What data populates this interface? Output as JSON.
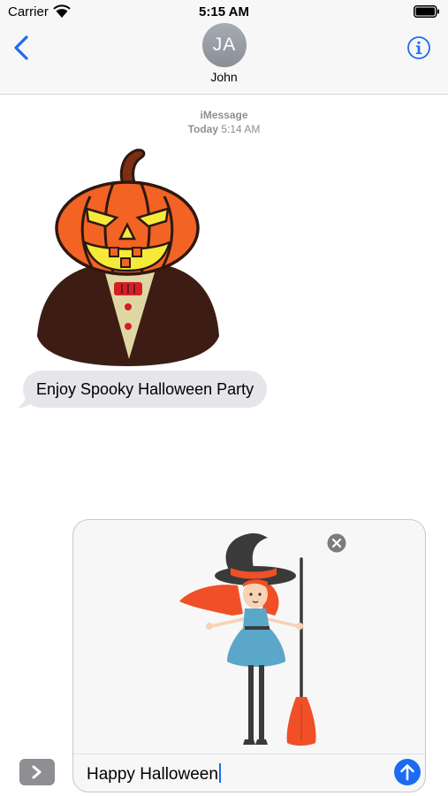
{
  "status_bar": {
    "carrier": "Carrier",
    "time": "5:15 AM"
  },
  "header": {
    "avatar_initials": "JA",
    "contact_name": "John",
    "back_icon": "chevron-left-icon",
    "info_icon": "info-icon"
  },
  "thread": {
    "service": "iMessage",
    "day": "Today",
    "time": "5:14 AM",
    "messages": [
      {
        "type": "sticker",
        "content": "pumpkin-head-sticker"
      },
      {
        "type": "text",
        "content": "Enjoy Spooky Halloween Party"
      }
    ]
  },
  "composer": {
    "attachment": "witch-sticker",
    "text": "Happy Halloween",
    "apps_icon": "chevron-right-icon",
    "send_icon": "arrow-up-icon",
    "remove_icon": "close-icon"
  },
  "colors": {
    "accent": "#1b6cf2",
    "received_bubble": "#e5e5ea",
    "header_bg": "#f7f7f7",
    "secondary_text": "#8e8e93"
  }
}
